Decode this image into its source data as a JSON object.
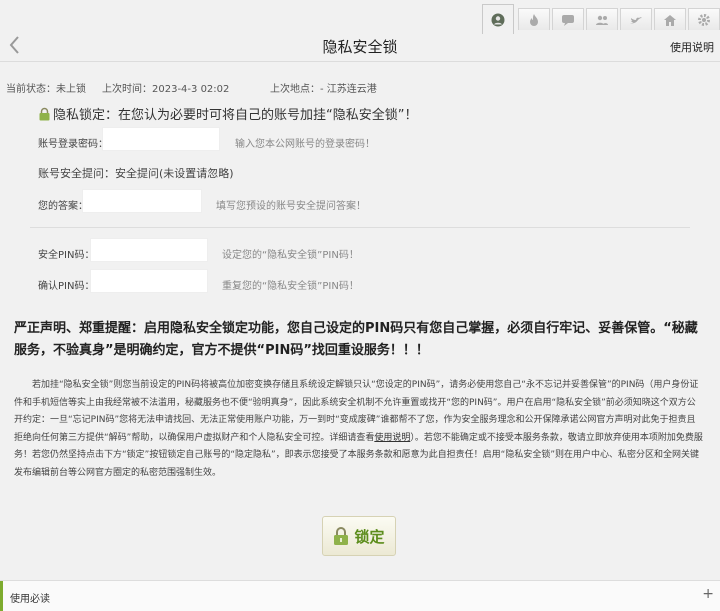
{
  "tabs": [
    {
      "icon": "avatar-icon"
    },
    {
      "icon": "fire-icon"
    },
    {
      "icon": "chat-icon"
    },
    {
      "icon": "users-icon"
    },
    {
      "icon": "bird-icon"
    },
    {
      "icon": "home-icon"
    },
    {
      "icon": "gear-icon"
    }
  ],
  "header": {
    "title": "隐私安全锁",
    "help": "使用说明"
  },
  "status": {
    "state_label": "当前状态：未上锁",
    "time_label": "上次时间：2023-4-3 02:02",
    "place_label": "上次地点：- 江苏连云港"
  },
  "form": {
    "heading": "隐私锁定：在您认为必要时可将自己的账号加挂“隐私安全锁”！",
    "password_label": "账号登录密码：",
    "password_value": "",
    "password_hint": "输入您本公网账号的登录密码！",
    "question_label": "账号安全提问：安全提问(未设置请忽略)",
    "answer_label": "您的答案：",
    "answer_value": "",
    "answer_hint": "填写您预设的账号安全提问答案！",
    "pin_label": "安全PIN码：",
    "pin_value": "",
    "pin_hint": "设定您的“隐私安全锁”PIN码！",
    "pin_confirm_label": "确认PIN码：",
    "pin_confirm_value": "",
    "pin_confirm_hint": "重复您的“隐私安全锁”PIN码！"
  },
  "warning": "严正声明、郑重提醒：启用隐私安全锁定功能，您自己设定的PIN码只有您自己掌握，必须自行牢记、妥善保管。“秘藏服务，不验真身”是明确约定，官方不提供“PIN码”找回重设服务！！！",
  "paragraph": {
    "part1": "若加挂“隐私安全锁”则您当前设定的PIN码将被高位加密变换存储且系统设定解锁只认“您设定的PIN码”，请务必使用您自己“永不忘记并妥善保管”的PIN码（用户身份证件和手机短信等实上由我经常被不法滥用，秘藏服务也不便“验明真身”，因此系统安全机制不允许重置或找开“您的PIN码”。用户在启用“隐私安全锁”前必须知晓这个双方公开约定：一旦“忘记PIN码”您将无法申请找回、无法正常使用账户功能，万一到时“变成废碑”谁都帮不了您，作为安全服务理念和公开保障承诺公网官方声明对此免于担责且拒绝向任何第三方提供“解码”帮助，以确保用户虚拟财产和个人隐私安全可控。详细请查看",
    "link": "使用说明",
    "part2": "）。若您不能确定或不接受本服务条款，敬请立即放弃使用本项附加免费服务！若您仍然坚持点击下方“锁定”按钮锁定自己账号的“隐定隐私”，即表示您接受了本服务条款和愿意为此自担责任！启用“隐私安全锁”则在用户中心、私密分区和全网关键发布编辑前台等公网官方圈定的私密范围强制生效。"
  },
  "lock_button": "锁定",
  "footer": {
    "label": "使用必读",
    "expand": "+"
  },
  "colors": {
    "accent": "#7dab2e",
    "lock_text": "#5c8d1c"
  }
}
